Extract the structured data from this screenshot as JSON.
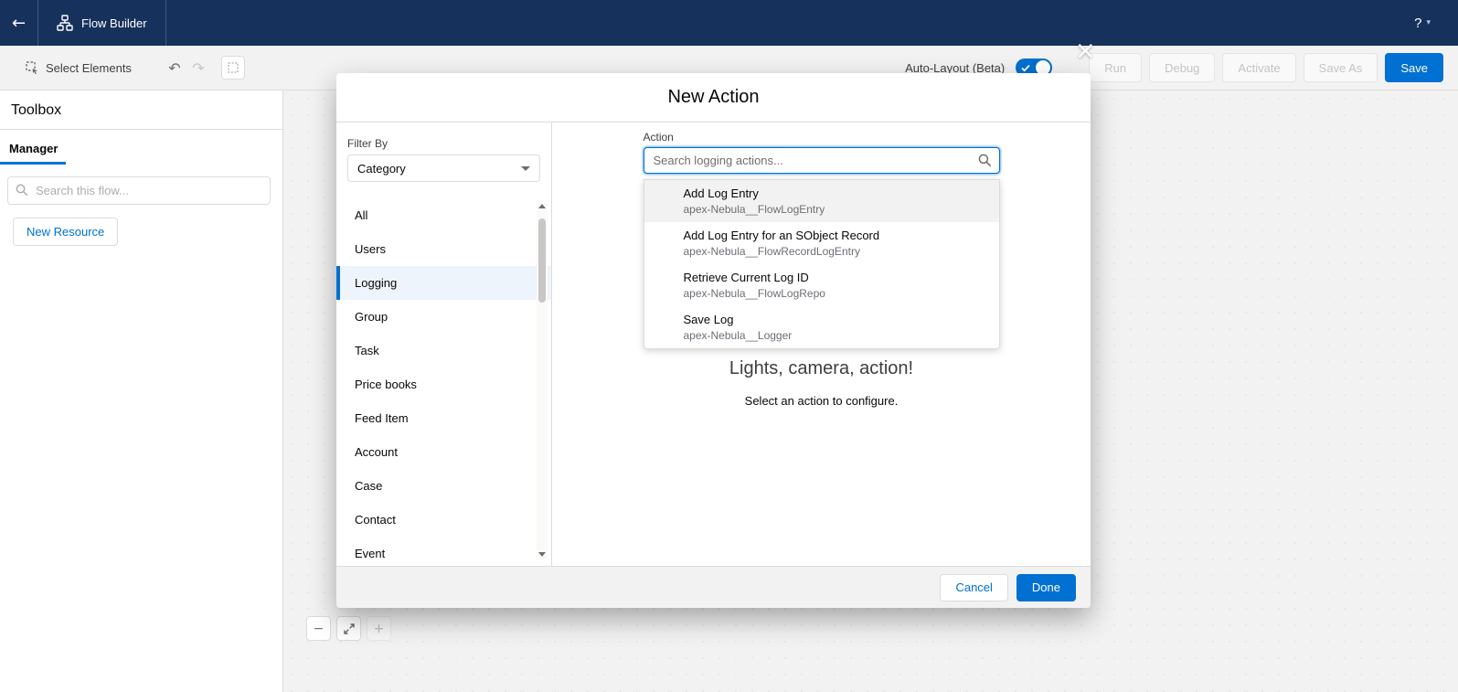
{
  "colors": {
    "brand": "#0070d2",
    "nav": "#16325c",
    "selected_bg": "#eef4fb"
  },
  "icons": {
    "back": "←",
    "help": "?",
    "caret": "▾",
    "undo": "↶",
    "redo": "↷",
    "zoom_out": "−",
    "zoom_in": "+",
    "close": "×"
  },
  "top_nav": {
    "app_name": "Flow Builder"
  },
  "toolbar": {
    "select_elements_label": "Select Elements",
    "auto_layout_label": "Auto-Layout (Beta)",
    "disabled_buttons": [
      "Run",
      "Debug",
      "Activate",
      "Save As"
    ],
    "save_label": "Save"
  },
  "sidebar": {
    "title": "Toolbox",
    "active_tab": "Manager",
    "search_placeholder": "Search this flow...",
    "new_resource_label": "New Resource"
  },
  "modal": {
    "title": "New Action",
    "filter_by_label": "Filter By",
    "category_dropdown_value": "Category",
    "categories": [
      "All",
      "Users",
      "Logging",
      "Group",
      "Task",
      "Price books",
      "Feed Item",
      "Account",
      "Case",
      "Contact",
      "Event"
    ],
    "selected_category": "Logging",
    "action_label": "Action",
    "search_placeholder": "Search logging actions...",
    "results": [
      {
        "title": "Add Log Entry",
        "subtitle": "apex-Nebula__FlowLogEntry"
      },
      {
        "title": "Add Log Entry for an SObject Record",
        "subtitle": "apex-Nebula__FlowRecordLogEntry"
      },
      {
        "title": "Retrieve Current Log ID",
        "subtitle": "apex-Nebula__FlowLogRepo"
      },
      {
        "title": "Save Log",
        "subtitle": "apex-Nebula__Logger"
      }
    ],
    "empty_state": {
      "heading": "Lights, camera, action!",
      "subtext": "Select an action to configure."
    },
    "footer": {
      "cancel_label": "Cancel",
      "done_label": "Done"
    }
  }
}
